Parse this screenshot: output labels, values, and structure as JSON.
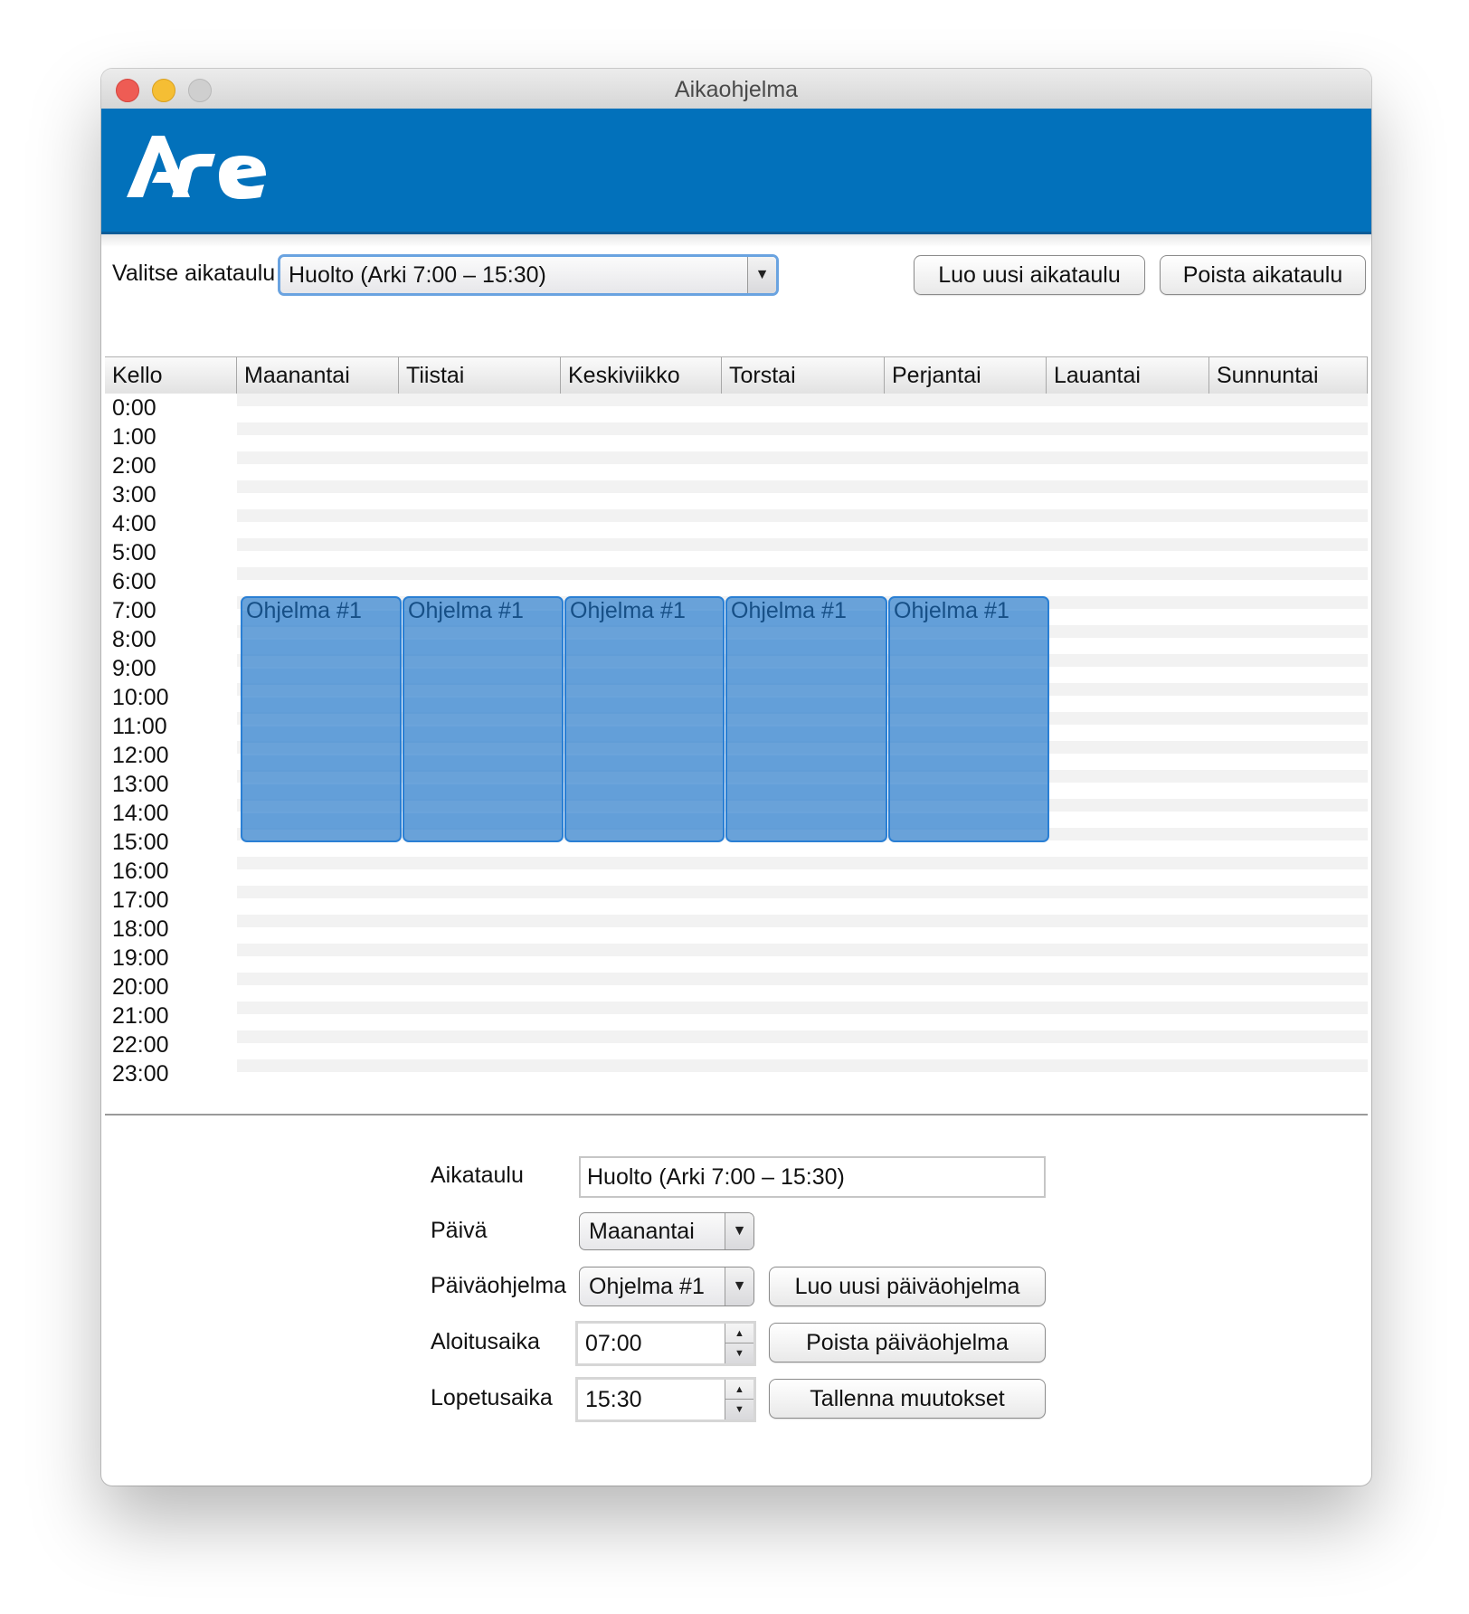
{
  "window": {
    "title": "Aikaohjelma"
  },
  "brand": {
    "logo_text": "ARe",
    "banner_color": "#0271bb"
  },
  "toolbar": {
    "select_label": "Valitse aikataulu",
    "selected_schedule": "Huolto (Arki 7:00 – 15:30)",
    "new_schedule_button": "Luo uusi aikataulu",
    "delete_schedule_button": "Poista aikataulu"
  },
  "table": {
    "columns": [
      "Kello",
      "Maanantai",
      "Tiistai",
      "Keskiviikko",
      "Torstai",
      "Perjantai",
      "Lauantai",
      "Sunnuntai"
    ],
    "hours": [
      "0:00",
      "1:00",
      "2:00",
      "3:00",
      "4:00",
      "5:00",
      "6:00",
      "7:00",
      "8:00",
      "9:00",
      "10:00",
      "11:00",
      "12:00",
      "13:00",
      "14:00",
      "15:00",
      "16:00",
      "17:00",
      "18:00",
      "19:00",
      "20:00",
      "21:00",
      "22:00",
      "23:00"
    ],
    "blocks": [
      {
        "day": "Maanantai",
        "label": "Ohjelma #1",
        "start": "07:00",
        "end": "15:30"
      },
      {
        "day": "Tiistai",
        "label": "Ohjelma #1",
        "start": "07:00",
        "end": "15:30"
      },
      {
        "day": "Keskiviikko",
        "label": "Ohjelma #1",
        "start": "07:00",
        "end": "15:30"
      },
      {
        "day": "Torstai",
        "label": "Ohjelma #1",
        "start": "07:00",
        "end": "15:30"
      },
      {
        "day": "Perjantai",
        "label": "Ohjelma #1",
        "start": "07:00",
        "end": "15:30"
      }
    ],
    "block_color": "#4a8ed2"
  },
  "form": {
    "schedule_label": "Aikataulu",
    "schedule_value": "Huolto (Arki 7:00 – 15:30)",
    "day_label": "Päivä",
    "day_value": "Maanantai",
    "program_label": "Päiväohjelma",
    "program_value": "Ohjelma #1",
    "new_program_button": "Luo uusi päiväohjelma",
    "start_label": "Aloitusaika",
    "start_value": "07:00",
    "delete_program_button": "Poista päiväohjelma",
    "end_label": "Lopetusaika",
    "end_value": "15:30",
    "save_button": "Tallenna muutokset"
  }
}
